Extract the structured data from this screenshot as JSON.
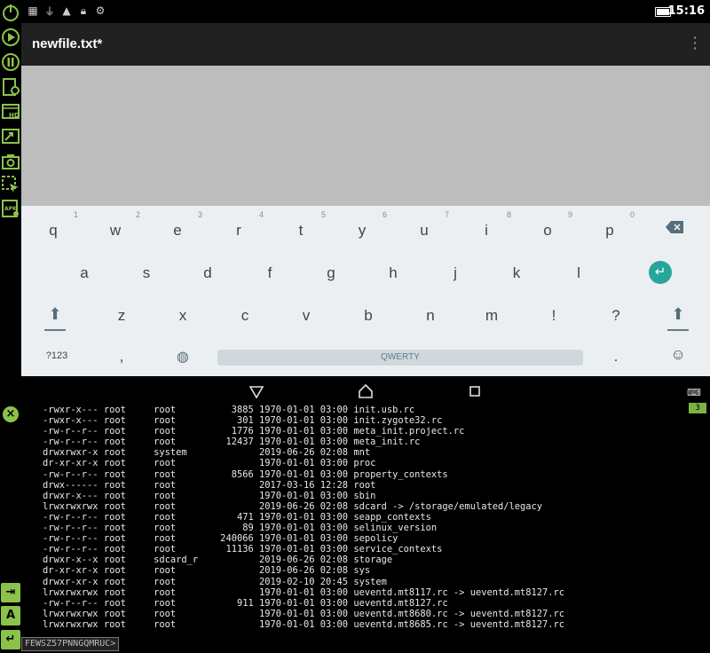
{
  "status_bar": {
    "icons": [
      "image-icon",
      "usb-icon",
      "warning-icon",
      "lock-icon",
      "android-debug-icon"
    ],
    "battery": "battery-icon",
    "time": "15:16"
  },
  "left_tools": [
    "power-icon",
    "play-icon",
    "pause-icon",
    "device-settings-icon",
    "screen-hd-icon",
    "screen-resize-icon",
    "screenshot-icon",
    "crop-icon",
    "apk-settings-icon"
  ],
  "app_bar": {
    "title": "newfile.txt*",
    "menu_icon": "overflow-menu-icon"
  },
  "keyboard": {
    "row1": [
      {
        "key": "q",
        "hint": "1"
      },
      {
        "key": "w",
        "hint": "2"
      },
      {
        "key": "e",
        "hint": "3"
      },
      {
        "key": "r",
        "hint": "4"
      },
      {
        "key": "t",
        "hint": "5"
      },
      {
        "key": "y",
        "hint": "6"
      },
      {
        "key": "u",
        "hint": "7"
      },
      {
        "key": "i",
        "hint": "8"
      },
      {
        "key": "o",
        "hint": "9"
      },
      {
        "key": "p",
        "hint": "0"
      }
    ],
    "row2": [
      "a",
      "s",
      "d",
      "f",
      "g",
      "h",
      "j",
      "k",
      "l"
    ],
    "row3": [
      "z",
      "x",
      "c",
      "v",
      "b",
      "n",
      "m",
      "!",
      "?"
    ],
    "symbols_key": "?123",
    "comma_key": ",",
    "space_label": "QWERTY",
    "period_key": ".",
    "accent_color": "#26a69a"
  },
  "terminal": {
    "badge": "3",
    "lines": [
      "-rwxr-x--- root     root          3885 1970-01-01 03:00 init.usb.rc",
      "-rwxr-x--- root     root           301 1970-01-01 03:00 init.zygote32.rc",
      "-rw-r--r-- root     root          1776 1970-01-01 03:00 meta_init.project.rc",
      "-rw-r--r-- root     root         12437 1970-01-01 03:00 meta_init.rc",
      "drwxrwxr-x root     system             2019-06-26 02:08 mnt",
      "dr-xr-xr-x root     root               1970-01-01 03:00 proc",
      "-rw-r--r-- root     root          8566 1970-01-01 03:00 property_contexts",
      "drwx------ root     root               2017-03-16 12:28 root",
      "drwxr-x--- root     root               1970-01-01 03:00 sbin",
      "lrwxrwxrwx root     root               2019-06-26 02:08 sdcard -> /storage/emulated/legacy",
      "-rw-r--r-- root     root           471 1970-01-01 03:00 seapp_contexts",
      "-rw-r--r-- root     root            89 1970-01-01 03:00 selinux_version",
      "-rw-r--r-- root     root        240066 1970-01-01 03:00 sepolicy",
      "-rw-r--r-- root     root         11136 1970-01-01 03:00 service_contexts",
      "drwxr-x--x root     sdcard_r           2019-06-26 02:08 storage",
      "dr-xr-xr-x root     root               2019-06-26 02:08 sys",
      "drwxr-xr-x root     root               2019-02-10 20:45 system",
      "lrwxrwxrwx root     root               1970-01-01 03:00 ueventd.mt8117.rc -> ueventd.mt8127.rc",
      "-rw-r--r-- root     root           911 1970-01-01 03:00 ueventd.mt8127.rc",
      "lrwxrwxrwx root     root               1970-01-01 03:00 ueventd.mt8680.rc -> ueventd.mt8127.rc",
      "lrwxrwxrwx root     root               1970-01-01 03:00 ueventd.mt8685.rc -> ueventd.mt8127.rc"
    ]
  },
  "command": {
    "value": "FEWSZ57PNNGQMRUC>"
  }
}
